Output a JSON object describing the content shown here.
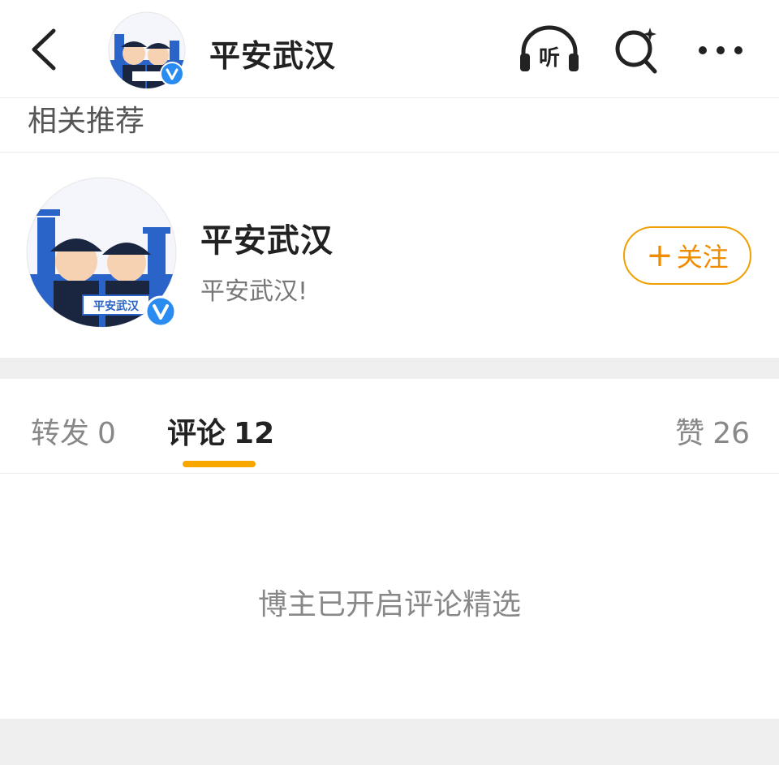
{
  "header": {
    "title": "平安武汉",
    "back_icon": "chevron-left-icon",
    "listen_icon": "headphones-icon",
    "listen_label": "听",
    "search_icon": "search-icon",
    "more_icon": "more-horizontal-icon"
  },
  "recommend": {
    "section_label": "相关推荐",
    "account": {
      "name": "平安武汉",
      "description": "平安武汉!",
      "follow_label": "关注",
      "verified": true,
      "avatar_banner_text": "平安武汉"
    }
  },
  "tabs": [
    {
      "label": "转发",
      "count": "0"
    },
    {
      "label": "评论",
      "count": "12",
      "active": true
    },
    {
      "label": "赞",
      "count": "26"
    }
  ],
  "comments": {
    "empty_note": "博主已开启评论精选"
  },
  "colors": {
    "accent": "#f7a700",
    "follow_text": "#f08c00",
    "verified_blue": "#2a8cf0",
    "avatar_blue": "#2b64c8"
  }
}
